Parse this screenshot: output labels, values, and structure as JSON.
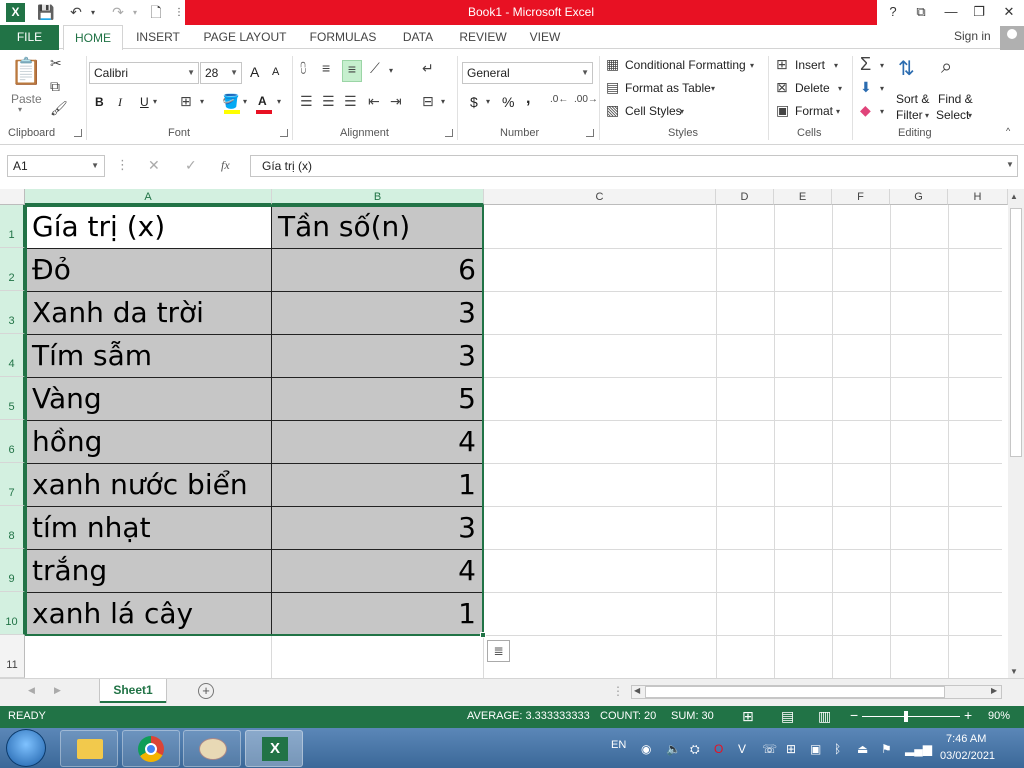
{
  "window": {
    "title": "Book1 - Microsoft Excel",
    "help": "?",
    "minimize": "🗕",
    "restore": "🗗",
    "close": "✕"
  },
  "ribbon_tabs": [
    "FILE",
    "HOME",
    "INSERT",
    "PAGE LAYOUT",
    "FORMULAS",
    "DATA",
    "REVIEW",
    "VIEW"
  ],
  "signin": "Sign in",
  "clipboard": {
    "paste": "Paste",
    "label": "Clipboard"
  },
  "font": {
    "name": "Calibri",
    "size": "28",
    "bold": "B",
    "italic": "I",
    "underline": "U",
    "grow": "A",
    "shrink": "A",
    "label": "Font"
  },
  "alignment": {
    "label": "Alignment"
  },
  "number": {
    "format": "General",
    "currency": "$",
    "percent": "%",
    "comma": ",",
    "label": "Number"
  },
  "styles": {
    "conditional": "Conditional Formatting",
    "table": "Format as Table",
    "cell_styles": "Cell Styles",
    "label": "Styles"
  },
  "cells": {
    "insert": "Insert",
    "delete": "Delete",
    "format": "Format",
    "label": "Cells"
  },
  "editing": {
    "sort": "Sort &",
    "sort2": "Filter",
    "find": "Find &",
    "find2": "Select",
    "label": "Editing"
  },
  "formula_bar": {
    "name_box": "A1",
    "fx": "fx",
    "content": "Gía trị (x)"
  },
  "columns": [
    "A",
    "B",
    "C",
    "D",
    "E",
    "F",
    "G",
    "H"
  ],
  "rows": [
    "1",
    "2",
    "3",
    "4",
    "5",
    "6",
    "7",
    "8",
    "9",
    "10",
    "11"
  ],
  "table": {
    "header": [
      "Gía trị (x)",
      "Tần số(n)"
    ],
    "rows": [
      [
        "Đỏ",
        "6"
      ],
      [
        "Xanh da trời",
        "3"
      ],
      [
        "Tím sẫm",
        "3"
      ],
      [
        "Vàng",
        "5"
      ],
      [
        "hồng",
        "4"
      ],
      [
        "xanh nước biển",
        "1"
      ],
      [
        "tím nhạt",
        "3"
      ],
      [
        "trắng",
        "4"
      ],
      [
        "xanh lá cây",
        "1"
      ]
    ]
  },
  "sheet": {
    "tab": "Sheet1",
    "add": "+"
  },
  "status": {
    "ready": "READY",
    "average": "AVERAGE: 3.333333333",
    "count": "COUNT: 20",
    "sum": "SUM: 30",
    "zoom": "90%"
  },
  "taskbar": {
    "lang": "EN",
    "time": "7:46 AM",
    "date": "03/02/2021"
  }
}
